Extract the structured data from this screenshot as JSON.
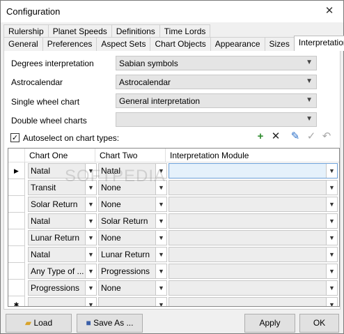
{
  "window": {
    "title": "Configuration",
    "close_label": "✕"
  },
  "tabs_row1": [
    "Rulership",
    "Planet Speeds",
    "Definitions",
    "Time Lords"
  ],
  "tabs_row2": [
    "General",
    "Preferences",
    "Aspect Sets",
    "Chart Objects",
    "Appearance",
    "Sizes",
    "Interpretation"
  ],
  "fields": {
    "degrees_label": "Degrees interpretation",
    "degrees_value": "Sabian symbols",
    "astro_label": "Astrocalendar",
    "astro_value": "Astrocalendar",
    "single_label": "Single wheel chart",
    "single_value": "General interpretation",
    "double_label": "Double wheel charts",
    "double_value": ""
  },
  "autoselect_label": "Autoselect on chart types:",
  "grid": {
    "headers": [
      "Chart One",
      "Chart Two",
      "Interpretation Module"
    ],
    "rows": [
      {
        "one": "Natal",
        "two": "Natal",
        "module": ""
      },
      {
        "one": "Transit",
        "two": "None",
        "module": ""
      },
      {
        "one": "Solar Return",
        "two": "None",
        "module": ""
      },
      {
        "one": "Natal",
        "two": "Solar Return",
        "module": ""
      },
      {
        "one": "Lunar Return",
        "two": "None",
        "module": ""
      },
      {
        "one": "Natal",
        "two": "Lunar Return",
        "module": ""
      },
      {
        "one": "Any Type of ...",
        "two": "Progressions",
        "module": ""
      },
      {
        "one": "Progressions",
        "two": "None",
        "module": ""
      }
    ]
  },
  "buttons": {
    "load": "Load",
    "save": "Save As ...",
    "apply": "Apply",
    "ok": "OK"
  },
  "watermark": "SOFTPEDIA"
}
